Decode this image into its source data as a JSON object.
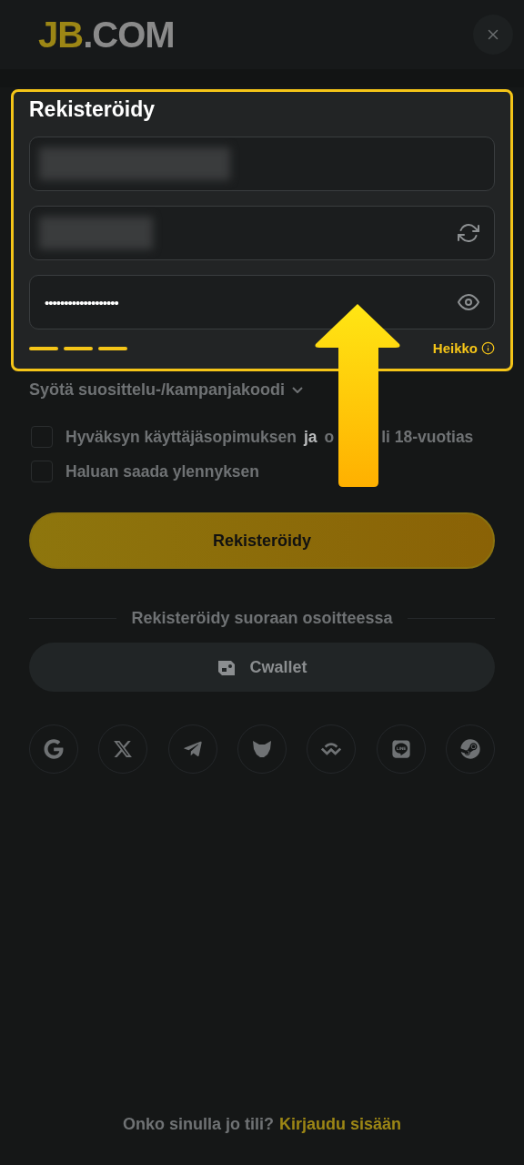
{
  "header": {
    "logo_primary": "JB",
    "logo_secondary": ".COM"
  },
  "form": {
    "title": "Rekisteröidy",
    "fields": [
      {
        "kind": "redacted"
      },
      {
        "kind": "generated"
      },
      {
        "kind": "password",
        "value": "•••••••••••••••••••"
      }
    ],
    "strength_segments": [
      {
        "on": true
      },
      {
        "on": true
      },
      {
        "on": true
      }
    ],
    "strength_label": "Heikko"
  },
  "promo_toggle": "Syötä suosittelu-/kampanjakoodi",
  "checkboxes": [
    {
      "checked": false,
      "parts": [
        "Hyväksyn käyttäjäsopimuksen",
        "ja",
        "o",
        "li 18-vuotias"
      ]
    },
    {
      "checked": false,
      "parts": [
        "Haluan saada ylennyksen"
      ]
    }
  ],
  "submit": "Rekisteröidy",
  "divider_text": "Rekisteröidy suoraan osoitteessa",
  "wallet_button": "Cwallet",
  "socials": [
    {
      "kind": "google"
    },
    {
      "kind": "x"
    },
    {
      "kind": "telegram"
    },
    {
      "kind": "metamask"
    },
    {
      "kind": "walletconnect"
    },
    {
      "kind": "line"
    },
    {
      "kind": "steam"
    }
  ],
  "footer": {
    "question": "Onko sinulla jo tili?",
    "link": "Kirjaudu sisään"
  },
  "annotation": {
    "kind": "arrow"
  }
}
